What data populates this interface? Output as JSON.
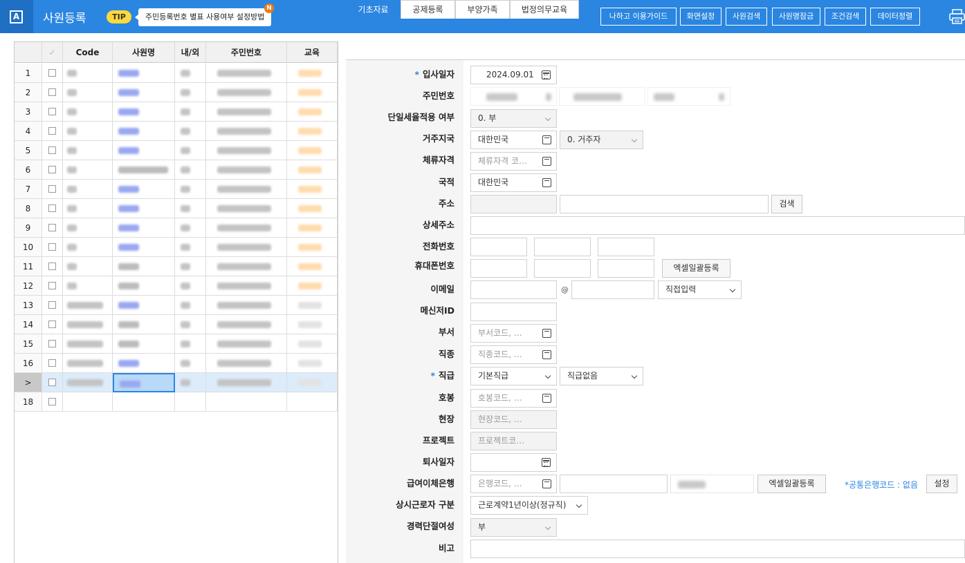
{
  "header": {
    "logo_letter": "A",
    "title": "사원등록",
    "tip_label": "TIP",
    "tip_text": "주민등록번호 별표 사용여부 설정방법",
    "new_badge": "N",
    "buttons": [
      "나하고 이용가이드",
      "화면설정",
      "사원검색",
      "사원명잠금",
      "조건검색",
      "데이터정렬"
    ],
    "print_icon": "printer-icon"
  },
  "grid": {
    "columns": [
      "Code",
      "사원명",
      "내/외",
      "주민번호",
      "교육"
    ],
    "check_header": "✓",
    "row_numbers": [
      "1",
      "2",
      "3",
      "4",
      "5",
      "6",
      "7",
      "8",
      "9",
      "10",
      "11",
      "12",
      "13",
      "14",
      "15",
      "16",
      "",
      "18"
    ],
    "selected_marker": ">"
  },
  "tabs": [
    "기초자료",
    "공제등록",
    "부양가족",
    "법정의무교육"
  ],
  "form": {
    "labels": {
      "hire_date": "입사일자",
      "resident_no": "주민번호",
      "flat_tax": "단일세율적용 여부",
      "residence_country": "거주지국",
      "stay_status": "체류자격",
      "nationality": "국적",
      "address": "주소",
      "address_detail": "상세주소",
      "phone": "전화번호",
      "mobile": "휴대폰번호",
      "email": "이메일",
      "messenger": "메신저ID",
      "department": "부서",
      "job_type": "직종",
      "position": "직급",
      "salary_step": "호봉",
      "site": "현장",
      "project": "프로젝트",
      "resign_date": "퇴사일자",
      "bank": "급여이체은행",
      "worker_type": "상시근로자 구분",
      "career_break": "경력단절여성",
      "note": "비고"
    },
    "required_mark": "*",
    "values": {
      "hire_date": "2024.09.01",
      "flat_tax": "0. 부",
      "residence_country": "대한민국",
      "residence_type": "0. 거주자",
      "nationality": "대한민국",
      "position": "기본직급",
      "position_level": "직급없음",
      "worker_type": "근로계약1년이상(정규직)",
      "career_break": "부",
      "email_domain": "직접입력",
      "at_sign": "@"
    },
    "placeholders": {
      "stay_status": "체류자격 코…",
      "department": "부서코드, …",
      "job_type": "직종코드, …",
      "salary_step": "호봉코드, …",
      "site": "현장코드, …",
      "project": "프로젝트코…",
      "bank": "은행코드, …"
    },
    "buttons": {
      "search": "검색",
      "excel_upload_mobile": "엑셀일괄등록",
      "excel_upload_bank": "엑셀일괄등록",
      "settings": "설정"
    },
    "bank_note": "*공통은행코드 : 없음"
  },
  "colors": {
    "header_bg": "#2a86e0",
    "accent": "#2a86e0",
    "tip_yellow": "#ffd93b",
    "new_badge": "#f07a16",
    "selected_row": "#dcecfb"
  }
}
